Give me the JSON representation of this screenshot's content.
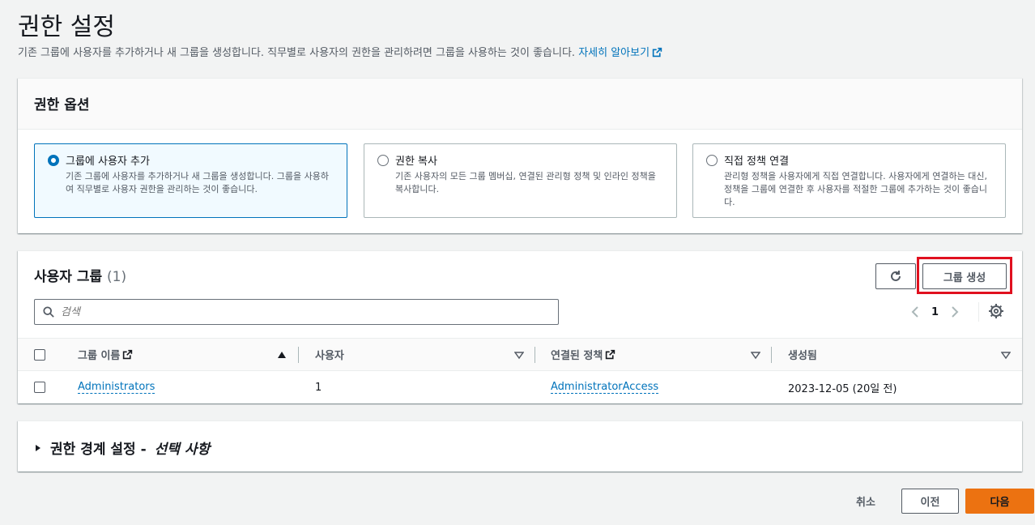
{
  "page": {
    "title": "권한 설정",
    "description": "기존 그룹에 사용자를 추가하거나 새 그룹을 생성합니다. 직무별로 사용자의 권한을 관리하려면 그룹을 사용하는 것이 좋습니다.",
    "learn_more": "자세히 알아보기"
  },
  "permission_options": {
    "title": "권한 옵션",
    "options": [
      {
        "title": "그룹에 사용자 추가",
        "description": "기존 그룹에 사용자를 추가하거나 새 그룹을 생성합니다. 그룹을 사용하여 직무별로 사용자 권한을 관리하는 것이 좋습니다.",
        "selected": true
      },
      {
        "title": "권한 복사",
        "description": "기존 사용자의 모든 그룹 멤버십, 연결된 관리형 정책 및 인라인 정책을 복사합니다.",
        "selected": false
      },
      {
        "title": "직접 정책 연결",
        "description": "관리형 정책을 사용자에게 직접 연결합니다. 사용자에게 연결하는 대신, 정책을 그룹에 연결한 후 사용자를 적절한 그룹에 추가하는 것이 좋습니다.",
        "selected": false
      }
    ]
  },
  "user_groups": {
    "title": "사용자 그룹",
    "count": "(1)",
    "create_button": "그룹 생성",
    "search_placeholder": "검색",
    "page_number": "1",
    "columns": {
      "name": "그룹 이름",
      "users": "사용자",
      "policies": "연결된 정책",
      "created": "생성됨"
    },
    "rows": [
      {
        "name": "Administrators",
        "users": "1",
        "policies": "AdministratorAccess",
        "created": "2023-12-05 (20일 전)"
      }
    ]
  },
  "boundary": {
    "title": "권한 경계 설정 -",
    "optional": "선택 사항"
  },
  "footer": {
    "cancel": "취소",
    "previous": "이전",
    "next": "다음"
  },
  "colors": {
    "accent": "#0073bb",
    "primary_button": "#ec7211",
    "highlight": "#e0101f"
  }
}
